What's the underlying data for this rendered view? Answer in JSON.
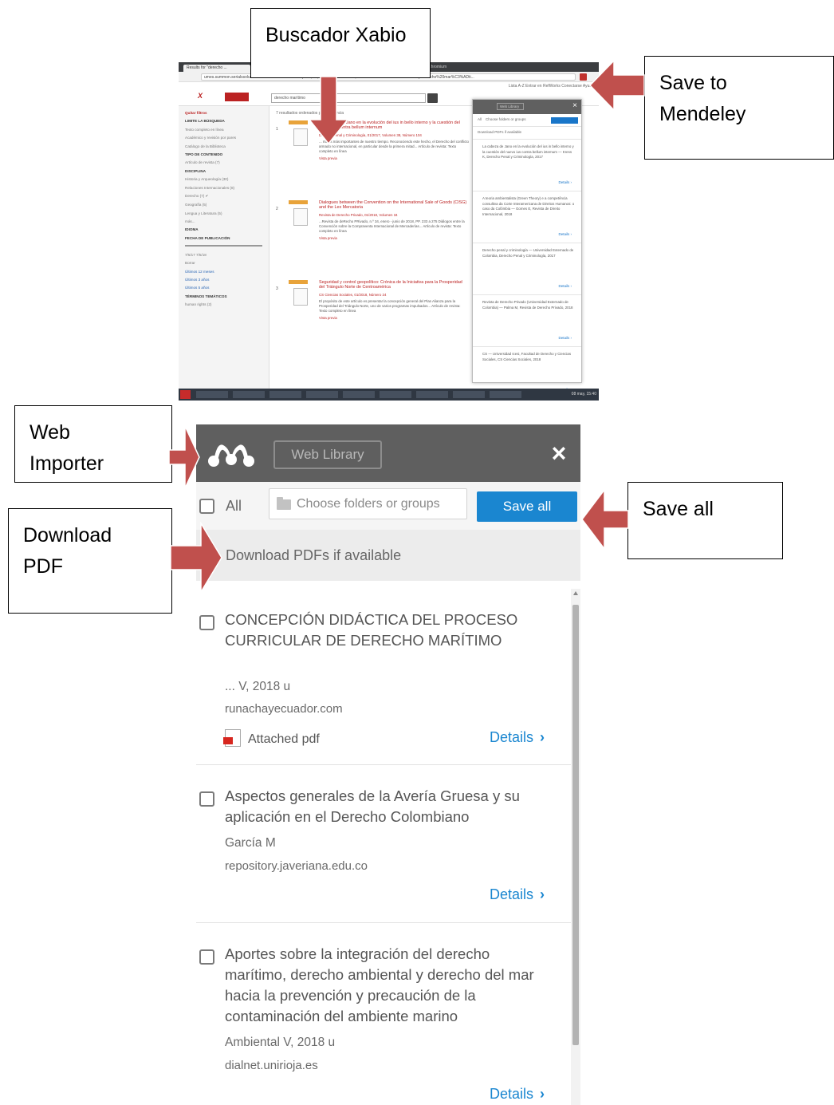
{
  "callouts": {
    "buscador": "Buscador Xabio",
    "save_mendeley_line1": "Save to",
    "save_mendeley_line2": "Mendeley",
    "web_importer_line1": "Web",
    "web_importer_line2": "Importer",
    "download_pdf_line1": "Download",
    "download_pdf_line2": "PDF",
    "save_all": "Save all"
  },
  "colors": {
    "arrow": "#c0504d",
    "mendeley_header": "#5f5f5f",
    "save_button": "#1a86d0",
    "details_link": "#1a86d0",
    "pdf_icon": "#d7261f"
  },
  "browser": {
    "tab_label": "Results for \"derecho ...",
    "window_title": "- Chromium",
    "url": "umes.summon.serialssolutions.com/#!/search?fvf=Discipline,law,f&rf=PublicationDate,2017-05-07:2018-05-07&l=es-ES&q=derecho%20mar%C3%ADti..."
  },
  "site": {
    "top_links": "Lista A-Z   Entrar en RefWorks   Conectarse   Ayuda",
    "search_value": "derecho marítimo",
    "result_count": "7 resultados ordenados por relevancia",
    "sidebar": [
      {
        "text": "Quitar filtros",
        "style": "red"
      },
      {
        "text": "LIMITE LA BÚSQUEDA",
        "style": "head"
      },
      {
        "text": "Texto completo en línea",
        "style": ""
      },
      {
        "text": "Académico y revisión por pares",
        "style": ""
      },
      {
        "text": "Catálogo de la Biblioteca",
        "style": ""
      },
      {
        "text": "TIPO DE CONTENIDO",
        "style": "head"
      },
      {
        "text": "Artículo de revista (7)",
        "style": ""
      },
      {
        "text": "DISCIPLINA",
        "style": "head"
      },
      {
        "text": "Historia y Arqueología (30)",
        "style": ""
      },
      {
        "text": "Relaciones Internacionales (8)",
        "style": ""
      },
      {
        "text": "Derecho (7) ✔",
        "style": ""
      },
      {
        "text": "Geografía (5)",
        "style": ""
      },
      {
        "text": "Lengua y Literatura (5)",
        "style": ""
      },
      {
        "text": "más...",
        "style": ""
      },
      {
        "text": "IDIOMA",
        "style": "head"
      },
      {
        "text": "FECHA DE PUBLICACIÓN",
        "style": "head"
      },
      {
        "text": "7/5/17      7/5/18",
        "style": ""
      },
      {
        "text": "Borrar",
        "style": ""
      },
      {
        "text": "Últimos 12 meses",
        "style": "link"
      },
      {
        "text": "Últimos 3 años",
        "style": "link"
      },
      {
        "text": "Últimos 5 años",
        "style": "link"
      },
      {
        "text": "TÉRMINOS TEMÁTICOS",
        "style": "head"
      },
      {
        "text": "human rights (2)",
        "style": ""
      }
    ],
    "results": [
      {
        "num": "1",
        "title": "La cabeza de Jano en la evolución del ius in bello interno y la cuestión del nuevo ius contra bellum internum",
        "meta": "Derecho Penal y Criminología, 01/2017, Volumen 38, Número 104",
        "snippet": "... males más importantes de nuestro tiempo. Reconociendo este hecho, el Derecho del conflicto armado no internacional, en particular desde la primera mitad... Artículo de revista: Texto completo en línea",
        "preview": "Vista previa"
      },
      {
        "num": "2",
        "title": "Dialogues between the Convention on the International Sale of Goods (CISG) and the Lex Mercatoria",
        "meta": "Revista de Derecho Privado, 01/2018, Volumen 34",
        "snippet": "...Revista de deRecho PRivado, n.º 34, enero - junio de 2018, PP. 233 a 275 Diálogos entre la Convención sobre la Compraventa Internacional de Mercaderías... Artículo de revista: Texto completo en línea",
        "preview": "Vista previa"
      },
      {
        "num": "3",
        "title": "Seguridad y control geopolítico: Crónica de la Iniciativa para la Prosperidad del Triángulo Norte de Centroamérica",
        "meta": "CS Ciencias Sociales, 01/2018, Número 24",
        "snippet": "El propósito de este artículo es presentar la concepción general del Plan Alianza para la Prosperidad del Triángulo Norte, uno de varios programas impulsados... Artículo de revista: Texto completo en línea",
        "preview": "Vista previa"
      }
    ],
    "mini_panel": {
      "web_library": "Web Library",
      "all": "All",
      "choose": "Choose folders or groups",
      "save_all": "Save all",
      "download": "Download PDFs if available",
      "items": [
        {
          "text": "La cabeza de Jano en la evolución del ius in bello interno y la cuestión del nuevo ius contra bellum internum — Kress K, Derecho Penal y Criminología, 2017",
          "details": "Details ›"
        },
        {
          "text": "A teoria ambientalista (Green Theory) e a competência consultiva da Corte Interamericana de Direitos Humanos: o caso da Colômbia — Gomes E, Revista de Direito Internacional, 2018",
          "details": "Details ›"
        },
        {
          "text": "Derecho penal y criminología — Universidad Externado de Colombia, Derecho Penal y Criminología, 2017",
          "details": "Details ›"
        },
        {
          "text": "Revista de Derecho Privado (Universidad Externado de Colombia) — Palma M, Revista de Derecho Privado, 2018",
          "details": "Details ›"
        },
        {
          "text": "CS — Universidad Icesi, Facultad de Derecho y Ciencias Sociales, CS Ciencias Sociales, 2018",
          "details": "Details ›"
        }
      ]
    },
    "clock": "08 may, 15:40"
  },
  "mendeley": {
    "web_library": "Web Library",
    "close_icon": "×",
    "all_label": "All",
    "folder_placeholder": "Choose folders or groups",
    "save_all": "Save all",
    "download_label": "Download PDFs if available",
    "items": [
      {
        "title": "CONCEPCIÓN DIDÁCTICA DEL PROCESO CURRICULAR DE DERECHO MARÍTIMO",
        "meta": "... V,  2018 u",
        "host": "runachayecuador.com",
        "attachment": "Attached pdf",
        "details": "Details"
      },
      {
        "title": "Aspectos generales de la Avería Gruesa y su aplicación en el Derecho Colombiano",
        "meta": "García M",
        "host": "repository.javeriana.edu.co",
        "details": "Details"
      },
      {
        "title": "Aportes sobre la integración del derecho marítimo, derecho ambiental y derecho del mar hacia la prevención y precaución de la contaminación del ambiente marino",
        "meta": "Ambiental V,  2018 u",
        "host": "dialnet.unirioja.es",
        "details": "Details"
      }
    ]
  }
}
